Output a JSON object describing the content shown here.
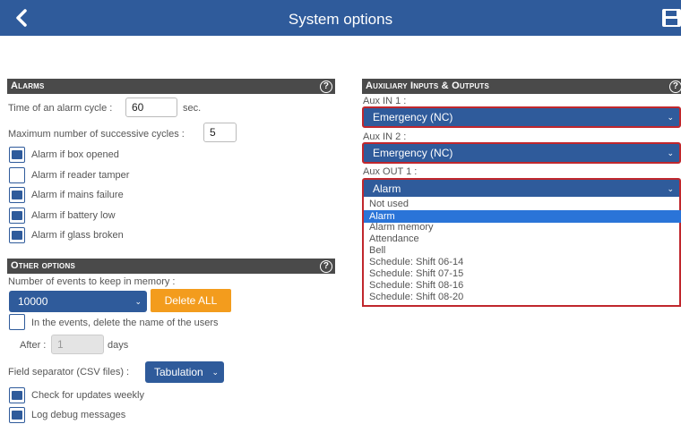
{
  "header": {
    "title": "System options",
    "back_icon": "chevron-left-icon",
    "save_icon": "save-icon"
  },
  "alarms": {
    "title": "Alarms",
    "help": "?",
    "cycle_label": "Time of an alarm cycle :",
    "cycle_value": "60",
    "cycle_unit": "sec.",
    "max_cycles_label": "Maximum number of successive cycles :",
    "max_cycles_value": "5",
    "options": [
      {
        "label": "Alarm if box opened",
        "checked": true
      },
      {
        "label": "Alarm if reader tamper",
        "checked": false
      },
      {
        "label": "Alarm if mains failure",
        "checked": true
      },
      {
        "label": "Alarm if battery low",
        "checked": true
      },
      {
        "label": "Alarm if glass broken",
        "checked": true
      }
    ]
  },
  "other": {
    "title": "Other options",
    "help": "?",
    "events_label": "Number of events to keep in memory :",
    "events_value": "10000",
    "delete_label": "Delete ALL",
    "delete_names_label": "In the events, delete the name of the users",
    "delete_names_checked": false,
    "after_label": "After :",
    "after_value": "1",
    "after_unit": "days",
    "separator_label": "Field separator (CSV files) :",
    "separator_value": "Tabulation",
    "updates_label": "Check for updates weekly",
    "updates_checked": true,
    "debug_label": "Log debug messages",
    "debug_checked": true
  },
  "aux": {
    "title": "Auxiliary Inputs & Outputs",
    "help": "?",
    "in1_label": "Aux IN 1 :",
    "in1_value": "Emergency (NC)",
    "in2_label": "Aux IN 2 :",
    "in2_value": "Emergency (NC)",
    "out1_label": "Aux OUT 1 :",
    "out1_value": "Alarm",
    "out1_options": [
      "Not used",
      "Alarm",
      "Alarm memory",
      "Attendance",
      "Bell",
      "Schedule: Shift 06-14",
      "Schedule: Shift 07-15",
      "Schedule: Shift 08-16",
      "Schedule: Shift 08-20"
    ],
    "out1_selected": 1
  },
  "colors": {
    "primary": "#2f5b9b",
    "header_dark": "#4a4a4a",
    "accent_orange": "#f39c1d",
    "highlight_red": "#c0272d",
    "selection_blue": "#2a74d8"
  }
}
